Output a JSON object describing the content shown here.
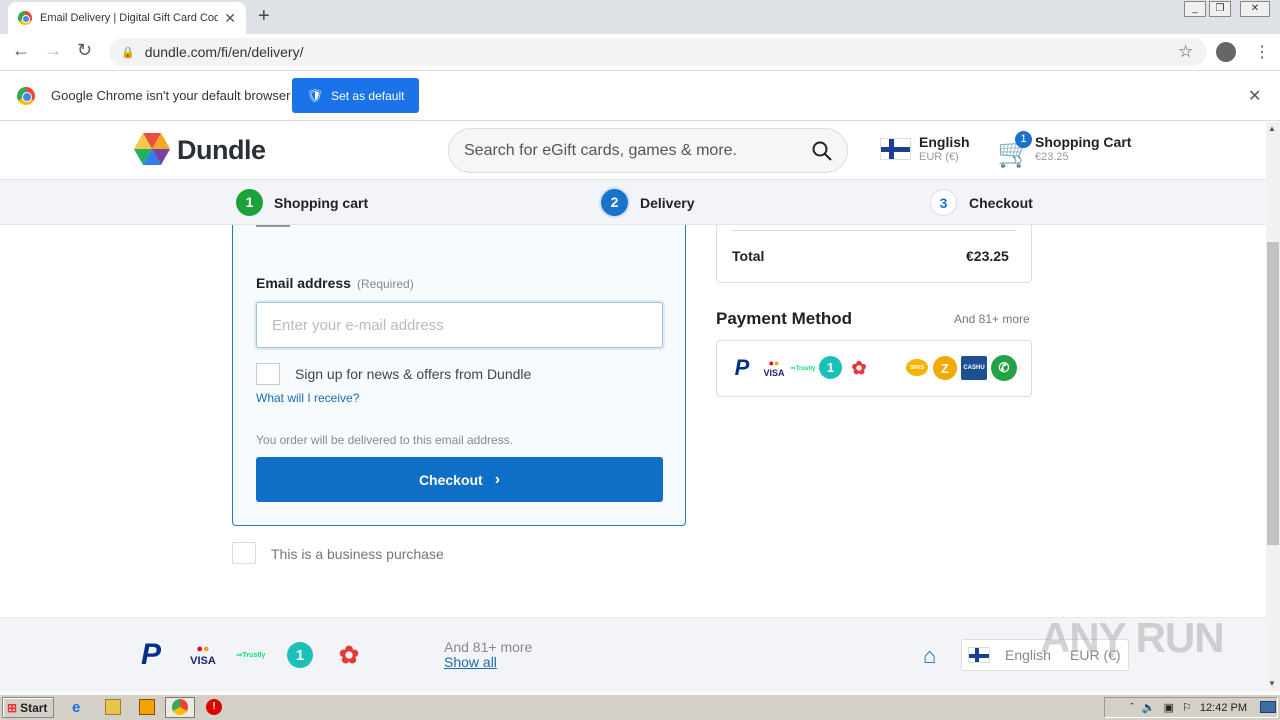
{
  "browser": {
    "tab_title": "Email Delivery | Digital Gift Card Cod",
    "url": "dundle.com/fi/en/delivery/"
  },
  "infobar": {
    "message": "Google Chrome isn't your default browser",
    "button": "Set as default"
  },
  "header": {
    "logo": "Dundle",
    "search_placeholder": "Search for eGift cards, games & more.",
    "language": "English",
    "currency": "EUR (€)",
    "cart_count": "1",
    "cart_label": "Shopping Cart",
    "cart_amount": "€23.25"
  },
  "steps": [
    {
      "num": "1",
      "label": "Shopping cart",
      "color": "#1aa33a"
    },
    {
      "num": "2",
      "label": "Delivery",
      "color": "#1a73c8"
    },
    {
      "num": "3",
      "label": "Checkout",
      "color": "#ffffff"
    }
  ],
  "form": {
    "email_label": "Email address",
    "email_required": "(Required)",
    "email_placeholder": "Enter your e-mail address",
    "newsletter": "Sign up for news & offers from Dundle",
    "receive_link": "What will I receive?",
    "delivery_note": "You order will be delivered to this email address.",
    "checkout_button": "Checkout",
    "business": "This is a business purchase"
  },
  "summary": {
    "total_label": "Total",
    "total_value": "€23.25"
  },
  "payment": {
    "title": "Payment Method",
    "more": "And 81+ more",
    "methods": [
      "paypal",
      "mastercard-visa",
      "trustly",
      "one",
      "flowers",
      "apple",
      "sms",
      "z",
      "cashu",
      "phone"
    ]
  },
  "footer": {
    "more": "And 81+ more",
    "show_all": "Show all",
    "language": "English",
    "currency": "EUR (€)"
  },
  "watermark": "ANY RUN",
  "taskbar": {
    "start": "Start",
    "time": "12:42 PM"
  }
}
